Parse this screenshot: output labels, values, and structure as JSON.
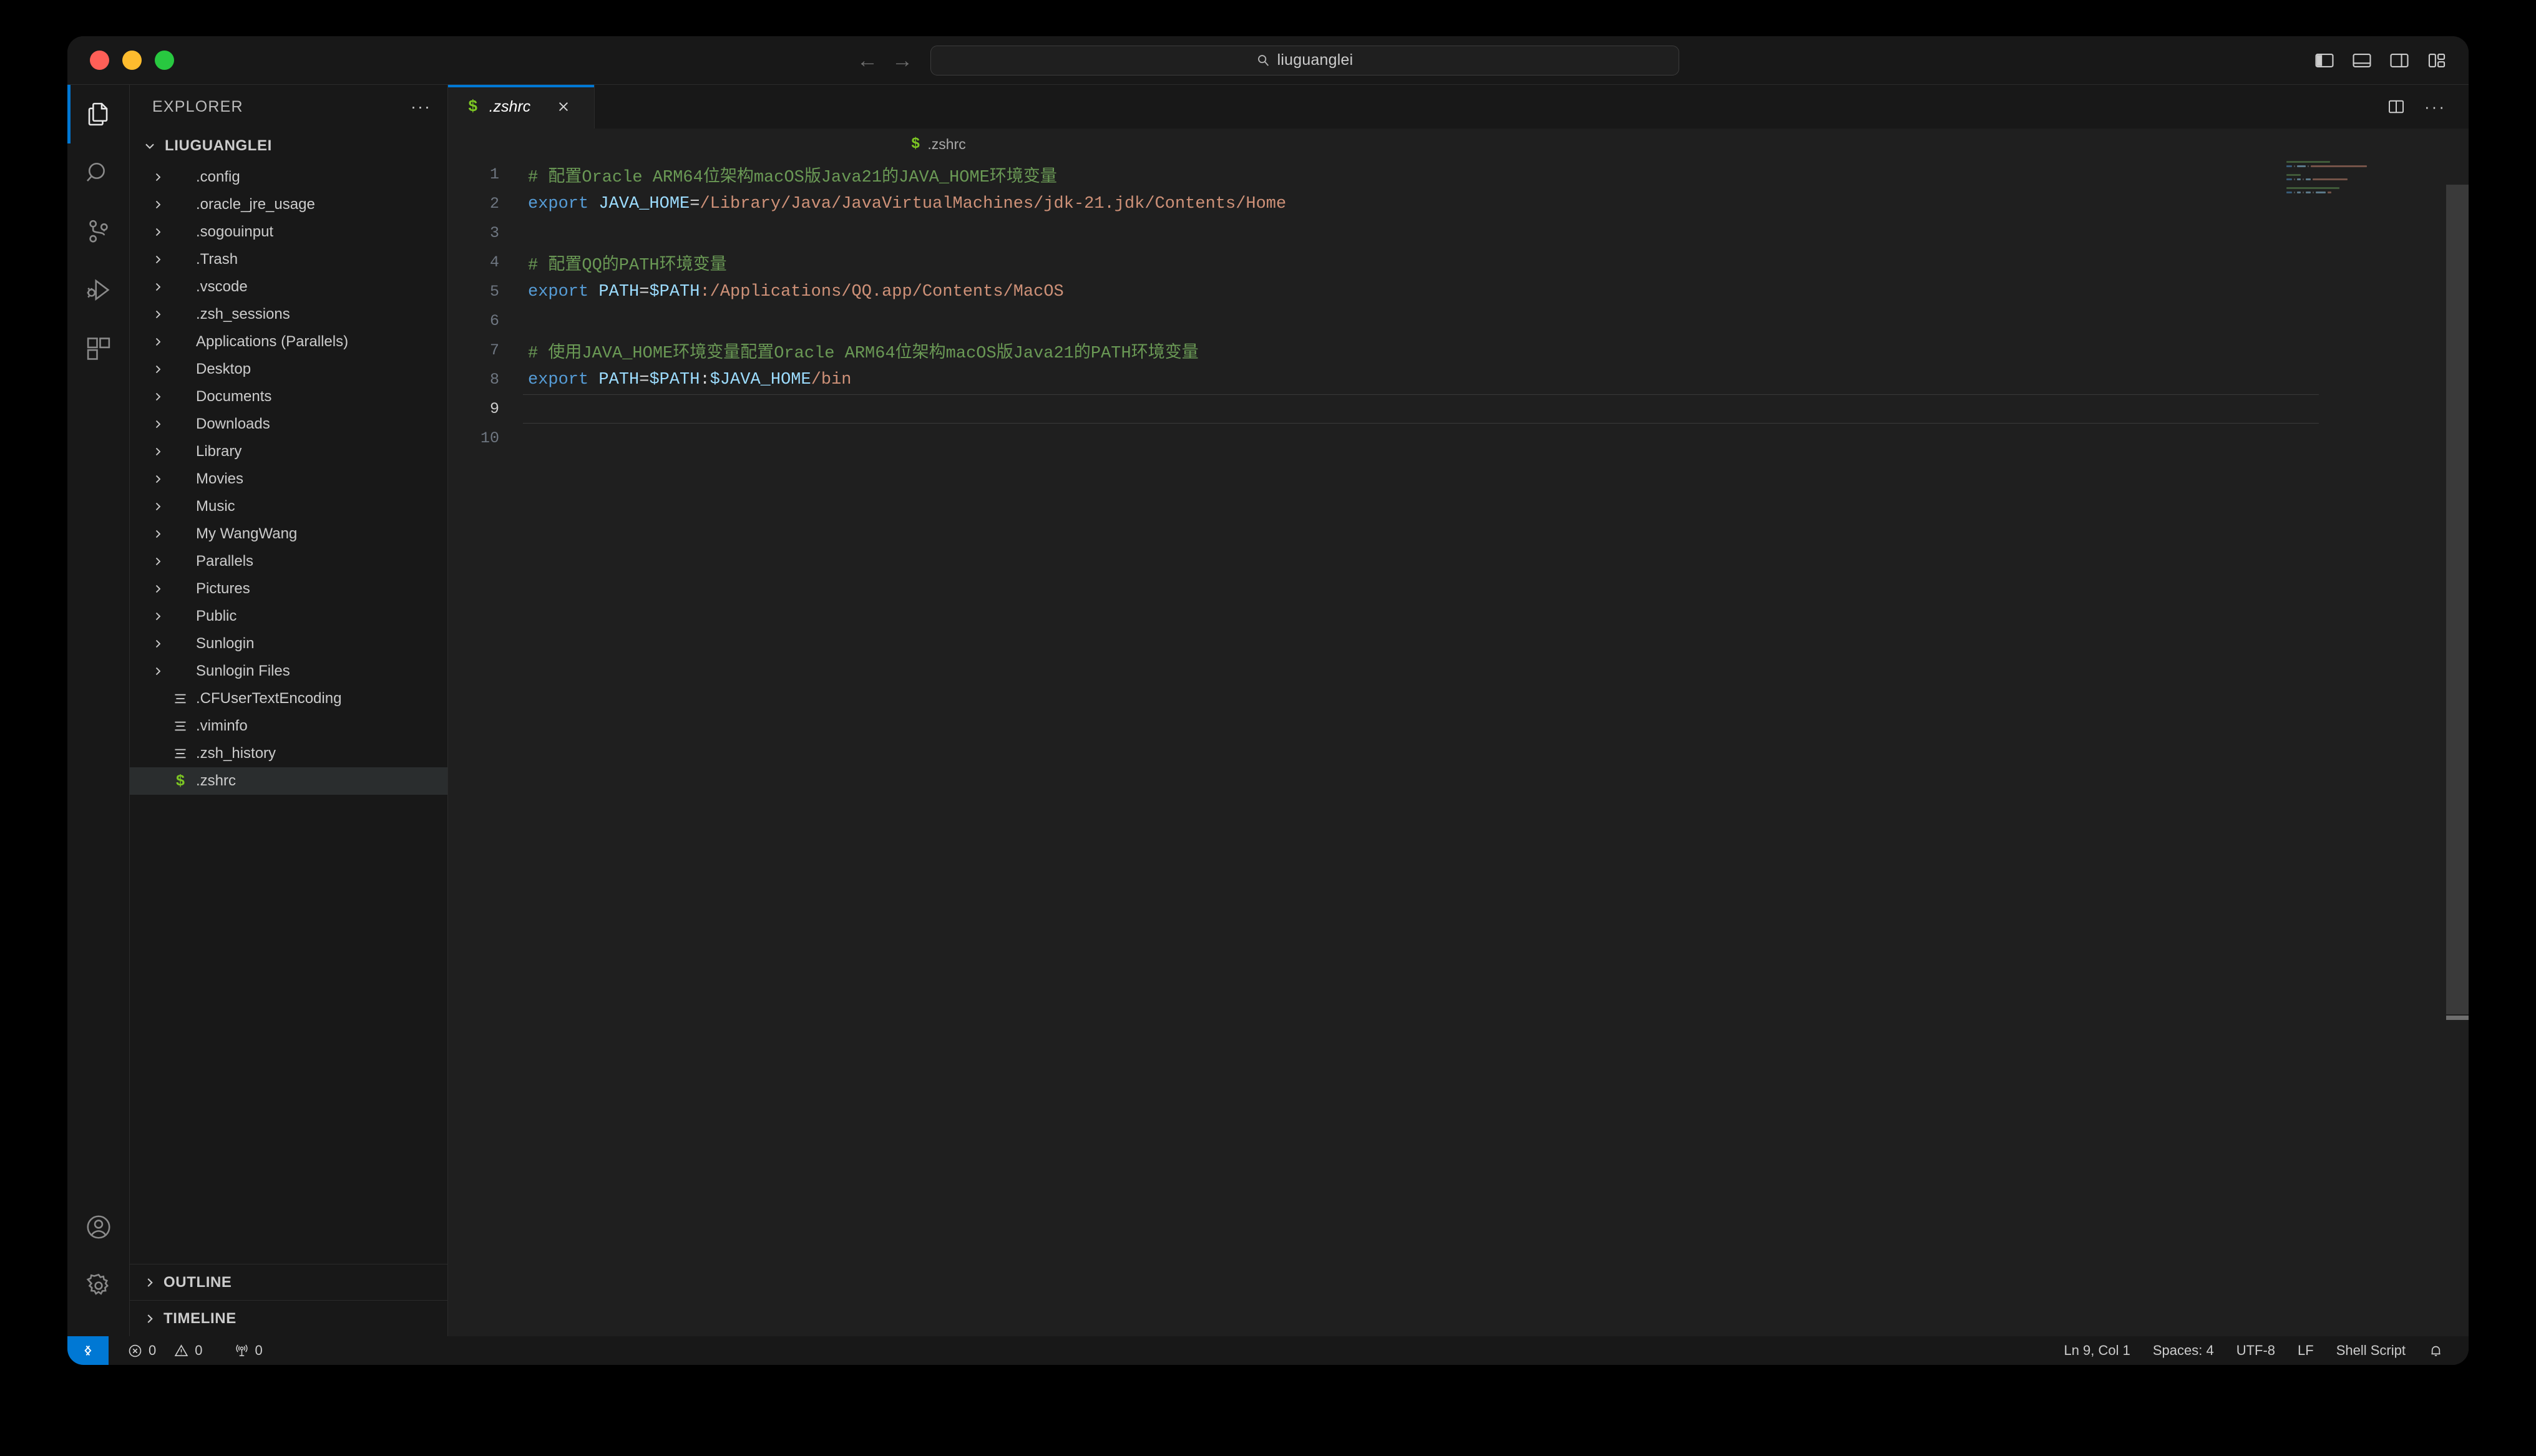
{
  "window": {
    "traffic_lights": [
      "close",
      "minimize",
      "maximize"
    ],
    "colors": {
      "close": "#ff5f57",
      "minimize": "#febc2e",
      "maximize": "#28c840",
      "accent": "#0078d4",
      "shell_green": "#7cc623"
    }
  },
  "titlebar": {
    "back_arrow": "←",
    "forward_arrow": "→",
    "command_center": {
      "icon": "search-icon",
      "text": "liuguanglei"
    },
    "layout_buttons": [
      {
        "name": "toggle-primary-sidebar",
        "state": "active"
      },
      {
        "name": "toggle-panel",
        "state": "inactive"
      },
      {
        "name": "toggle-secondary-sidebar",
        "state": "inactive"
      },
      {
        "name": "customize-layout",
        "state": "inactive"
      }
    ]
  },
  "activitybar": {
    "top": [
      {
        "name": "explorer",
        "icon": "files-icon",
        "active": true
      },
      {
        "name": "search",
        "icon": "search-icon",
        "active": false
      },
      {
        "name": "source-control",
        "icon": "source-control-icon",
        "active": false
      },
      {
        "name": "run-and-debug",
        "icon": "debug-icon",
        "active": false
      },
      {
        "name": "extensions",
        "icon": "extensions-icon",
        "active": false
      }
    ],
    "bottom": [
      {
        "name": "accounts",
        "icon": "account-icon"
      },
      {
        "name": "manage",
        "icon": "gear-icon"
      }
    ]
  },
  "sidebar": {
    "title": "EXPLORER",
    "more_actions": "···",
    "root": {
      "label": "LIUGUANGLEI",
      "expanded": true
    },
    "items": [
      {
        "label": ".config",
        "type": "folder"
      },
      {
        "label": ".oracle_jre_usage",
        "type": "folder"
      },
      {
        "label": ".sogouinput",
        "type": "folder"
      },
      {
        "label": ".Trash",
        "type": "folder"
      },
      {
        "label": ".vscode",
        "type": "folder"
      },
      {
        "label": ".zsh_sessions",
        "type": "folder"
      },
      {
        "label": "Applications (Parallels)",
        "type": "folder"
      },
      {
        "label": "Desktop",
        "type": "folder"
      },
      {
        "label": "Documents",
        "type": "folder"
      },
      {
        "label": "Downloads",
        "type": "folder"
      },
      {
        "label": "Library",
        "type": "folder"
      },
      {
        "label": "Movies",
        "type": "folder"
      },
      {
        "label": "Music",
        "type": "folder"
      },
      {
        "label": "My WangWang",
        "type": "folder"
      },
      {
        "label": "Parallels",
        "type": "folder"
      },
      {
        "label": "Pictures",
        "type": "folder"
      },
      {
        "label": "Public",
        "type": "folder"
      },
      {
        "label": "Sunlogin",
        "type": "folder"
      },
      {
        "label": "Sunlogin Files",
        "type": "folder"
      },
      {
        "label": ".CFUserTextEncoding",
        "type": "file"
      },
      {
        "label": ".viminfo",
        "type": "file"
      },
      {
        "label": ".zsh_history",
        "type": "file"
      },
      {
        "label": ".zshrc",
        "type": "shell",
        "selected": true
      }
    ],
    "sections": [
      {
        "label": "OUTLINE",
        "expanded": false
      },
      {
        "label": "TIMELINE",
        "expanded": false
      }
    ]
  },
  "editor": {
    "tabs": [
      {
        "label": ".zshrc",
        "icon": "shell-file-icon",
        "active": true,
        "preview": true,
        "close": "close-icon"
      }
    ],
    "actions": [
      {
        "name": "split-editor-right",
        "icon": "split-editor-icon"
      },
      {
        "name": "more-actions",
        "icon": "ellipsis-icon"
      }
    ],
    "breadcrumb": {
      "icon": "shell-file-icon",
      "text": ".zshrc"
    },
    "current_line": 9,
    "lines": [
      {
        "n": 1,
        "tokens": [
          {
            "t": "comment",
            "v": "# 配置Oracle ARM64位架构macOS版Java21的JAVA_HOME环境变量"
          }
        ]
      },
      {
        "n": 2,
        "tokens": [
          {
            "t": "kw",
            "v": "export"
          },
          {
            "t": "op",
            "v": " "
          },
          {
            "t": "var",
            "v": "JAVA_HOME"
          },
          {
            "t": "op",
            "v": "="
          },
          {
            "t": "str",
            "v": "/Library/Java/JavaVirtualMachines/jdk-21.jdk/Contents/Home"
          }
        ]
      },
      {
        "n": 3,
        "tokens": []
      },
      {
        "n": 4,
        "tokens": [
          {
            "t": "comment",
            "v": "# 配置QQ的PATH环境变量"
          }
        ]
      },
      {
        "n": 5,
        "tokens": [
          {
            "t": "kw",
            "v": "export"
          },
          {
            "t": "op",
            "v": " "
          },
          {
            "t": "var",
            "v": "PATH"
          },
          {
            "t": "op",
            "v": "="
          },
          {
            "t": "var",
            "v": "$PATH"
          },
          {
            "t": "str",
            "v": ":/Applications/QQ.app/Contents/MacOS"
          }
        ]
      },
      {
        "n": 6,
        "tokens": []
      },
      {
        "n": 7,
        "tokens": [
          {
            "t": "comment",
            "v": "# 使用JAVA_HOME环境变量配置Oracle ARM64位架构macOS版Java21的PATH环境变量"
          }
        ]
      },
      {
        "n": 8,
        "tokens": [
          {
            "t": "kw",
            "v": "export"
          },
          {
            "t": "op",
            "v": " "
          },
          {
            "t": "var",
            "v": "PATH"
          },
          {
            "t": "op",
            "v": "="
          },
          {
            "t": "var",
            "v": "$PATH"
          },
          {
            "t": "op",
            "v": ":"
          },
          {
            "t": "var",
            "v": "$JAVA_HOME"
          },
          {
            "t": "str",
            "v": "/bin"
          }
        ]
      },
      {
        "n": 9,
        "tokens": []
      },
      {
        "n": 10,
        "tokens": []
      }
    ]
  },
  "statusbar": {
    "remote": {
      "icon": "remote-icon",
      "label": ""
    },
    "problems": [
      {
        "icon": "error-icon",
        "value": "0"
      },
      {
        "icon": "warning-icon",
        "value": "0"
      },
      {
        "icon": "ports-icon",
        "value": "0"
      }
    ],
    "right": [
      {
        "name": "editor-position",
        "label": "Ln 9, Col 1"
      },
      {
        "name": "indentation",
        "label": "Spaces: 4"
      },
      {
        "name": "encoding",
        "label": "UTF-8"
      },
      {
        "name": "eol",
        "label": "LF"
      },
      {
        "name": "language-mode",
        "label": "Shell Script"
      }
    ],
    "notifications": {
      "icon": "bell-icon"
    }
  }
}
